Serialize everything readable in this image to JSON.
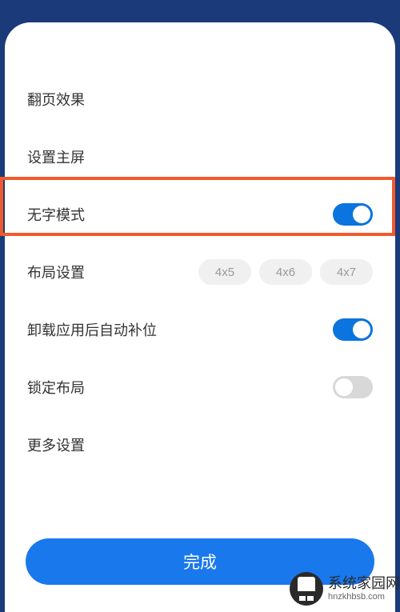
{
  "rows": {
    "pageEffect": {
      "label": "翻页效果"
    },
    "setHome": {
      "label": "设置主屏"
    },
    "textlessMode": {
      "label": "无字模式",
      "toggle": true
    },
    "layout": {
      "label": "布局设置",
      "options": [
        "4x5",
        "4x6",
        "4x7"
      ]
    },
    "autoFill": {
      "label": "卸载应用后自动补位",
      "toggle": true
    },
    "lockLayout": {
      "label": "锁定布局",
      "toggle": false
    },
    "moreSettings": {
      "label": "更多设置"
    }
  },
  "doneButton": "完成",
  "watermark": {
    "main": "系统家园网",
    "sub": "hnzkhbsb.com"
  }
}
